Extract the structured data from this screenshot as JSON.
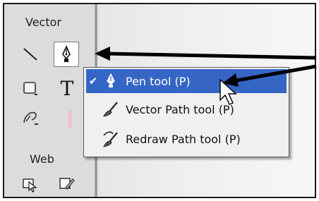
{
  "panel": {
    "sections": {
      "vector": "Vector",
      "web": "Web"
    },
    "tools": [
      {
        "name": "line-tool",
        "icon": "line-icon"
      },
      {
        "name": "pen-tool",
        "icon": "pen-nib-icon",
        "selected": true
      },
      {
        "name": "rectangle-tool",
        "icon": "rectangle-icon"
      },
      {
        "name": "text-tool",
        "icon": "text-icon",
        "glyph": "T"
      },
      {
        "name": "freeform-tool",
        "icon": "freeform-icon"
      },
      {
        "name": "hotspot-tool",
        "icon": "hotspot-icon"
      },
      {
        "name": "slice-tool",
        "icon": "slice-icon"
      }
    ]
  },
  "flyout": {
    "items": [
      {
        "label": "Pen tool (P)",
        "icon": "pen-nib-icon",
        "checked": true,
        "highlighted": true
      },
      {
        "label": "Vector Path tool (P)",
        "icon": "brush-icon",
        "checked": false
      },
      {
        "label": "Redraw Path tool (P)",
        "icon": "redraw-brush-icon",
        "checked": false
      }
    ],
    "check_glyph": "✔"
  },
  "colors": {
    "highlight": "#3566c6",
    "panel": "#dcdcdc",
    "annotation_arrow": "#000000"
  }
}
